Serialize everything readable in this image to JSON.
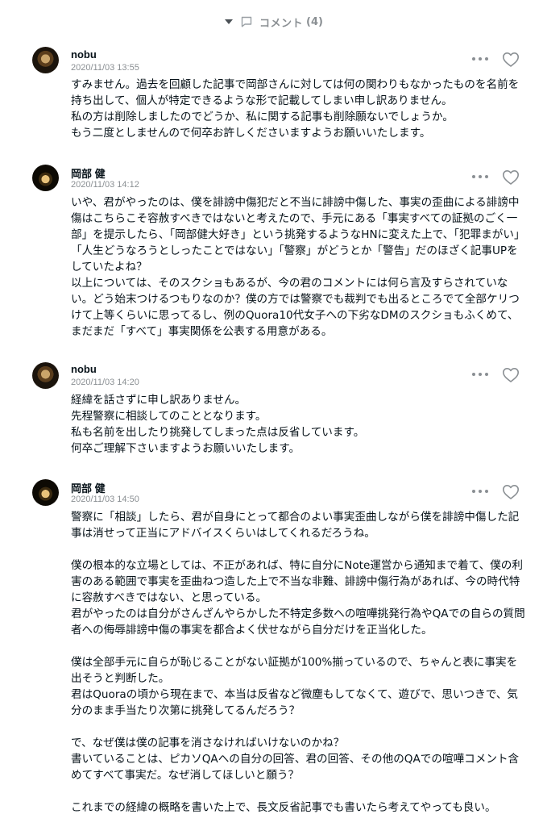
{
  "header": {
    "title": "コメント",
    "count": "(4)"
  },
  "comments": [
    {
      "author": "nobu",
      "date": "2020/11/03 13:55",
      "body": "すみません。過去を回顧した記事で岡部さんに対しては何の関わりもなかったものを名前を持ち出して、個人が特定できるような形で記載してしまい申し訳ありません。\n私の方は削除しましたのでどうか、私に関する記事も削除願ないでしょうか。\nもう二度としませんので何卒お許しくださいますようお願いいたします。"
    },
    {
      "author": "岡部 健",
      "date": "2020/11/03 14:12",
      "body": "いや、君がやったのは、僕を誹謗中傷犯だと不当に誹謗中傷した、事実の歪曲による誹謗中傷はこちらこそ容赦すべきではないと考えたので、手元にある「事実すべての証拠のごく一部」を提示したら、「岡部健大好き」という挑発するようなHNに変えた上で、「犯罪まがい」「人生どうなろうとしったことではない」「警察」がどうとか「警告」だのほざく記事UPをしていたよね？\n以上については、そのスクショもあるが、今の君のコメントには何ら言及すらされていない。どう始末つけるつもりなのか？僕の方では警察でも裁判でも出るところでて全部ケリつけて上等くらいに思ってるし、例のQuora10代女子への下劣なDMのスクショもふくめて、まだまだ「すべて」事実関係を公表する用意がある。"
    },
    {
      "author": "nobu",
      "date": "2020/11/03 14:20",
      "body": "経緯を話さずに申し訳ありません。\n先程警察に相談してのこととなります。\n私も名前を出したり挑発してしまった点は反省しています。\n何卒ご理解下さいますようお願いいたします。"
    },
    {
      "author": "岡部 健",
      "date": "2020/11/03 14:50",
      "body": "警察に「相談」したら、君が自身にとって都合のよい事実歪曲しながら僕を誹謗中傷した記事は消せって正当にアドバイスくらいはしてくれるだろうね。\n\n僕の根本的な立場としては、不正があれば、特に自分にNote運営から通知まで着て、僕の利害のある範囲で事実を歪曲ねつ造した上で不当な非難、誹謗中傷行為があれば、今の時代特に容赦すべきではない、と思っている。\n君がやったのは自分がさんざんやらかした不特定多数への喧嘩挑発行為やQAでの自らの質問者への侮辱誹謗中傷の事実を都合よく伏せながら自分だけを正当化した。\n\n僕は全部手元に自らが恥じることがない証拠が100%揃っているので、ちゃんと表に事実を出そうと判断した。\n君はQuoraの頃から現在まで、本当は反省など微塵もしてなくて、遊びで、思いつきで、気分のまま手当たり次第に挑発してるんだろう？\n\nで、なぜ僕は僕の記事を消さなければいけないのかね？\n書いていることは、ピカソQAへの自分の回答、君の回答、その他のQAでの喧嘩コメント含めてすべて事実だ。なぜ消してほしいと願う？\n\nこれまでの経緯の概略を書いた上で、長文反省記事でも書いたら考えてやっても良い。"
    }
  ]
}
